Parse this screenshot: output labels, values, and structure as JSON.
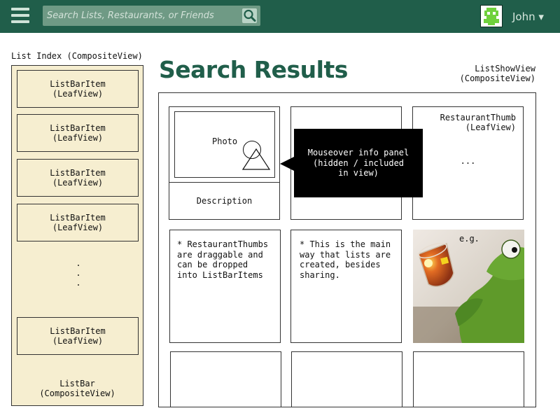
{
  "header": {
    "search_placeholder": "Search Lists, Restaurants, or Friends",
    "user_name": "John ▾",
    "colors": {
      "bar": "#205e4a",
      "search_field": "#6f9a85"
    }
  },
  "sidebar": {
    "label": "List Index (CompositeView)",
    "items": [
      "ListBarItem\n(LeafView)",
      "ListBarItem\n(LeafView)",
      "ListBarItem\n(LeafView)",
      "ListBarItem\n(LeafView)",
      "ListBarItem\n(LeafView)"
    ],
    "ellipsis": ".\n.\n.",
    "footer": "ListBar\n(CompositeView)"
  },
  "main": {
    "title": "Search Results",
    "show_view_label": "ListShowView\n(CompositeView)",
    "thumb1": {
      "photo_label": "Photo",
      "description": "Description"
    },
    "thumb3": {
      "label": "RestaurantThumb\n(LeafView)",
      "ellipsis": "..."
    },
    "tooltip": "Mouseover info panel\n(hidden / included\nin view)",
    "notes": [
      "* RestaurantThumbs\nare draggable and\ncan be dropped\ninto ListBarItems",
      "* This is the main\nway that lists are\ncreated, besides\nsharing."
    ],
    "example_label": "e.g."
  }
}
